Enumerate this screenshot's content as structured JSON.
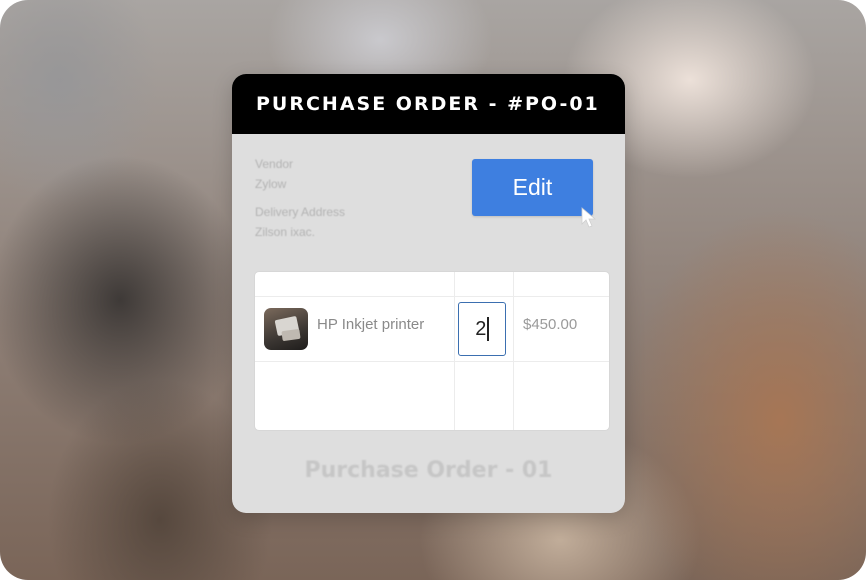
{
  "header": {
    "title": "PURCHASE ORDER - #PO-01"
  },
  "meta": {
    "vendor_label": "Vendor",
    "vendor_value": "Zylow",
    "address_label": "Delivery Address",
    "address_value": "Zilson ixac."
  },
  "actions": {
    "edit_label": "Edit"
  },
  "line_items": [
    {
      "product": "HP Inkjet printer",
      "quantity": "2",
      "price": "$450.00",
      "thumbnail_icon": "printer-thumbnail"
    }
  ],
  "footer": {
    "title": "Purchase Order - 01"
  },
  "colors": {
    "header_bg": "#000000",
    "edit_button": "#3e7fe0",
    "quantity_border": "#3b6fb0",
    "card_bg": "#dedede"
  }
}
